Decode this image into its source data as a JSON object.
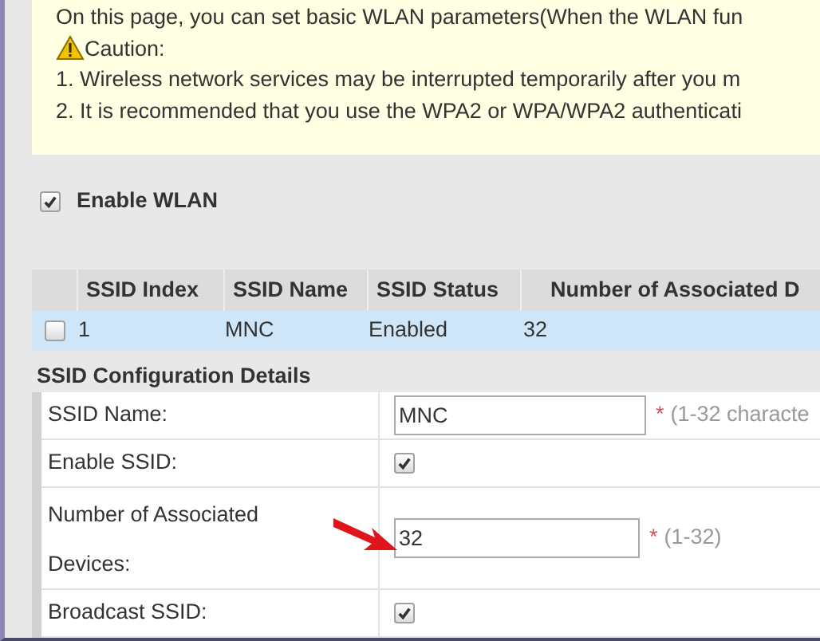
{
  "notice": {
    "intro": "On this page, you can set basic WLAN parameters(When the WLAN fun",
    "caution_title": "Caution:",
    "items": [
      "1. Wireless network services may be interrupted temporarily after you m",
      "2. It is recommended that you use the WPA2 or WPA/WPA2 authenticati"
    ]
  },
  "enable_wlan": {
    "label": "Enable WLAN",
    "checked": true
  },
  "ssid_table": {
    "columns": [
      "SSID Index",
      "SSID Name",
      "SSID Status",
      "Number of Associated D"
    ],
    "rows": [
      {
        "cells": [
          "1",
          "MNC",
          "Enabled",
          "32"
        ],
        "checked": false,
        "selected": true
      }
    ]
  },
  "details": {
    "title": "SSID Configuration Details",
    "fields": [
      {
        "kind": "text",
        "label": "SSID Name:",
        "value": "MNC",
        "required": "*",
        "hint": "(1-32 characte"
      },
      {
        "kind": "checkbox",
        "label": "Enable SSID:",
        "checked": true
      },
      {
        "kind": "text",
        "label": "Number of Associated Devices:",
        "value": "32",
        "required": "*",
        "hint": "(1-32)",
        "pointer": true
      },
      {
        "kind": "checkbox",
        "label": "Broadcast SSID:",
        "checked": true
      }
    ]
  }
}
